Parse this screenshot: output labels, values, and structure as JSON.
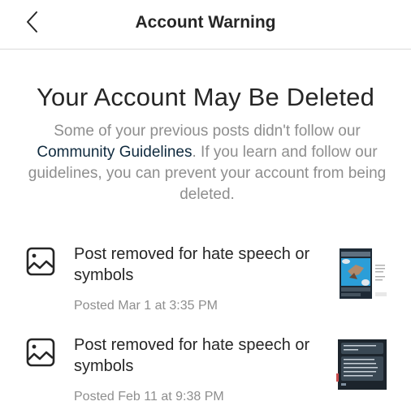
{
  "header": {
    "title": "Account Warning",
    "back_icon": "chevron-left-icon"
  },
  "main": {
    "title": "Your Account May Be Deleted",
    "description_before": "Some of your previous posts didn't follow our ",
    "link_text": "Community Guidelines",
    "description_after": ". If you learn and follow our guidelines, you can prevent your account from being deleted."
  },
  "posts": [
    {
      "icon": "image-icon",
      "reason": "Post removed for hate speech or symbols",
      "date": "Posted Mar 1 at 3:35 PM",
      "thumbnail": "post-thumbnail-1"
    },
    {
      "icon": "image-icon",
      "reason": "Post removed for hate speech or symbols",
      "date": "Posted Feb 11 at 9:38 PM",
      "thumbnail": "post-thumbnail-2"
    }
  ],
  "colors": {
    "text_primary": "#262626",
    "text_secondary": "#8e8e8e",
    "link": "#0f2a3e",
    "divider": "#dbdbdb"
  }
}
